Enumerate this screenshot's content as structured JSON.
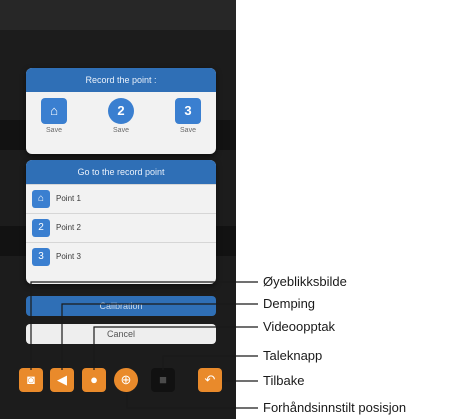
{
  "phone": {
    "status_text": "",
    "device_name": "",
    "device_sub": ""
  },
  "record_dialog": {
    "title": "Record the point :",
    "buttons": [
      {
        "icon": "home-icon",
        "glyph": "⌂",
        "label": "Save"
      },
      {
        "icon": "number-2-icon",
        "glyph": "2",
        "label": "Save"
      },
      {
        "icon": "number-3-icon",
        "glyph": "3",
        "label": "Save"
      }
    ]
  },
  "goto_dialog": {
    "title": "Go to the record point",
    "points": [
      {
        "icon": "home-icon",
        "glyph": "⌂",
        "label": "Point 1"
      },
      {
        "icon": "number-2-icon",
        "glyph": "2",
        "label": "Point 2"
      },
      {
        "icon": "number-3-icon",
        "glyph": "3",
        "label": "Point 3"
      }
    ]
  },
  "calibration_label": "Calibration",
  "cancel_label": "Cancel",
  "toolbar": [
    {
      "name": "snapshot-button",
      "icon": "camera-icon",
      "glyph": "◙"
    },
    {
      "name": "mute-button",
      "icon": "speaker-mute-icon",
      "glyph": "◀"
    },
    {
      "name": "record-video-button",
      "icon": "record-icon",
      "glyph": "●"
    },
    {
      "name": "preset-position-button",
      "icon": "crosshair-icon",
      "glyph": "⊕"
    },
    {
      "name": "talk-button",
      "icon": "microphone-icon",
      "glyph": "■"
    },
    {
      "name": "back-button",
      "icon": "back-arrow-icon",
      "glyph": "↶"
    }
  ],
  "callouts": {
    "snapshot": "Øyeblikksbilde",
    "mute": "Demping",
    "video": "Videoopptak",
    "talk": "Taleknapp",
    "back": "Tilbake",
    "preset": "Forhåndsinnstilt posisjon"
  },
  "colors": {
    "accent_blue": "#2f6fb6",
    "toolbar_orange": "#e98a2b"
  }
}
